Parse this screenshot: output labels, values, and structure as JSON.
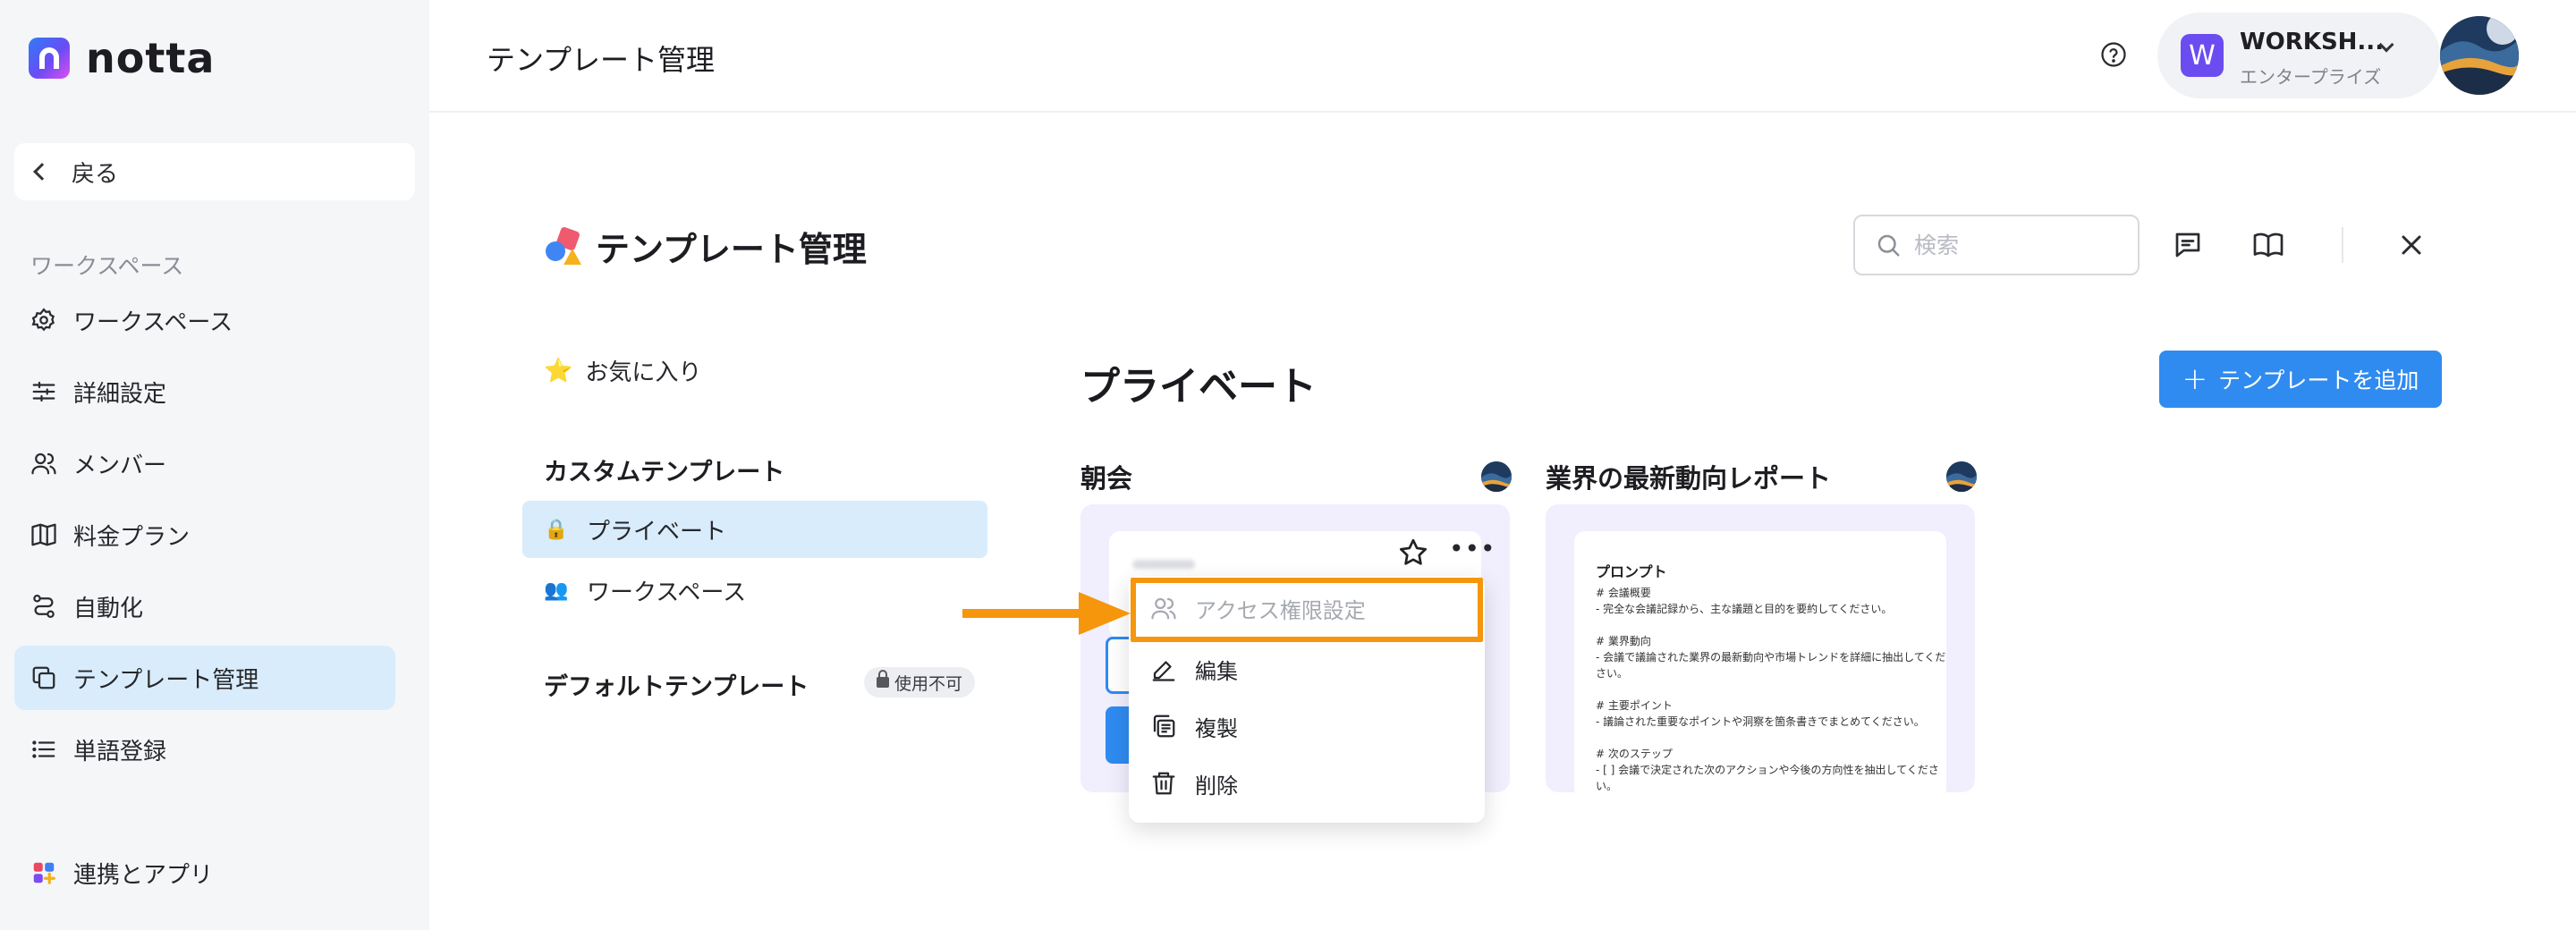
{
  "app": {
    "brand": "notta"
  },
  "sidebar": {
    "back_label": "戻る",
    "section_label": "ワークスペース",
    "items": [
      {
        "label": "ワークスペース",
        "icon": "gear-icon"
      },
      {
        "label": "詳細設定",
        "icon": "sliders-icon"
      },
      {
        "label": "メンバー",
        "icon": "users-icon"
      },
      {
        "label": "料金プラン",
        "icon": "map-icon"
      },
      {
        "label": "自動化",
        "icon": "automation-icon"
      },
      {
        "label": "テンプレート管理",
        "icon": "template-icon",
        "active": true
      },
      {
        "label": "単語登録",
        "icon": "list-icon"
      }
    ],
    "bottom_item": {
      "label": "連携とアプリ",
      "icon": "apps-icon"
    }
  },
  "header": {
    "title": "テンプレート管理",
    "workspace": {
      "initial": "W",
      "name": "WORKSH...",
      "plan": "エンタープライズ"
    }
  },
  "panel": {
    "title": "テンプレート管理",
    "search_placeholder": "検索",
    "favorites_label": "お気に入り",
    "custom_group": "カスタムテンプレート",
    "custom_items": [
      {
        "label": "プライベート",
        "emoji": "🔒",
        "active": true
      },
      {
        "label": "ワークスペース",
        "emoji": "👥"
      }
    ],
    "default_group": "デフォルトテンプレート",
    "default_badge": "使用不可",
    "section_heading": "プライベート",
    "add_button": "テンプレートを追加"
  },
  "cards": [
    {
      "title": "朝会"
    },
    {
      "title": "業界の最新動向レポート",
      "preview_heading": "プロンプト",
      "preview_lines": [
        "# 会議概要",
        "- 完全な会議記録から、主な議題と目的を要約してください。",
        "",
        "# 業界動向",
        "- 会議で議論された業界の最新動向や市場トレンドを詳細に抽出してくだ",
        "さい。",
        "",
        "# 主要ポイント",
        "- 議論された重要なポイントや洞察を箇条書きでまとめてください。",
        "",
        "# 次のステップ",
        "- [ ] 会議で決定された次のアクションや今後の方向性を抽出してくださ",
        "い。"
      ]
    }
  ],
  "menu": {
    "items": [
      {
        "label": "アクセス権限設定",
        "icon": "users-icon",
        "disabled": true,
        "highlighted": true
      },
      {
        "label": "編集",
        "icon": "pencil-icon"
      },
      {
        "label": "複製",
        "icon": "copy-icon"
      },
      {
        "label": "削除",
        "icon": "trash-icon"
      }
    ]
  },
  "colors": {
    "accent": "#2f8bf0",
    "active_bg": "#d9ecfb",
    "highlight": "#f5960d",
    "brand_purple": "#6b4cf0"
  }
}
